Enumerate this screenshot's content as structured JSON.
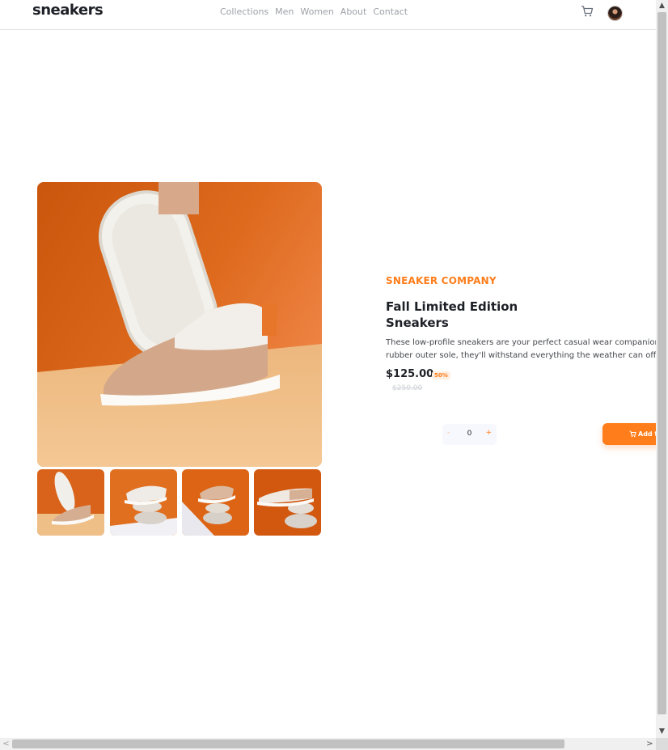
{
  "header": {
    "logo": "sneakers",
    "nav": [
      "Collections",
      "Men",
      "Women",
      "About",
      "Contact"
    ],
    "cart_icon": "cart-icon",
    "avatar": "avatar"
  },
  "gallery": {
    "main_image": "product-image-1",
    "thumbnails": [
      "product-thumbnail-1",
      "product-thumbnail-2",
      "product-thumbnail-3",
      "product-thumbnail-4"
    ]
  },
  "product": {
    "company": "SNEAKER COMPANY",
    "title": "Fall Limited Edition Sneakers",
    "description_line1": "These low-profile sneakers are your perfect casual wear companion",
    "description_line2": "rubber outer sole, they'll withstand everything the weather can offe",
    "price": "$125.00",
    "discount": "50%",
    "old_price": "$250.00"
  },
  "cart_controls": {
    "minus": "-",
    "quantity": "0",
    "plus": "+",
    "add_label": "Add t"
  },
  "scrollbars": {
    "up": "▲",
    "down": "▼",
    "left": "<",
    "right": ">"
  },
  "colors": {
    "accent": "#ff7d1a",
    "accent_pale": "#ffede0",
    "text_dark": "#1d2026",
    "text_grey": "#9ea1a8"
  }
}
